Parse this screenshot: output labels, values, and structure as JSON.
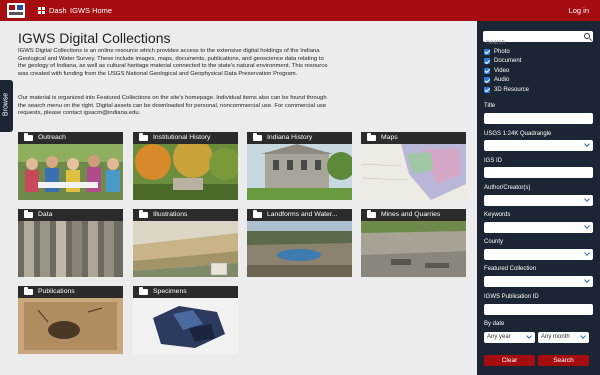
{
  "topbar": {
    "dash_label": "Dash",
    "home_label": "IGWS Home",
    "login_label": "Log in"
  },
  "browse_label": "Browse",
  "main": {
    "title": "IGWS Digital Collections",
    "intro": "IGWS Digital Collections is an online resource which provides access to the extensive digital holdings of the Indiana Geological and Water Survey. These include images, maps, documents, publications, and geoscience data relating to the geology of Indiana, as well as cultural heritage material connected to the state's natural environment. This resource was created with funding from the USGS National Geological and Geophysical Data Preservation Program.",
    "intro2": "Our material is organized into Featured Collections on the site's homepage. Individual items also can be found through the search menu on the right. Digital assets can be downloaded for personal, noncommercial use. For commercial use requests, please contact igsacm@indiana.edu.",
    "collections": [
      {
        "label": "Outreach"
      },
      {
        "label": "Institutional History"
      },
      {
        "label": "Indiana History"
      },
      {
        "label": "Maps"
      },
      {
        "label": "Data"
      },
      {
        "label": "Illustrations"
      },
      {
        "label": "Landforms and Water..."
      },
      {
        "label": "Mines and Quarries"
      },
      {
        "label": "Publications"
      },
      {
        "label": "Specimens"
      }
    ]
  },
  "sidebar": {
    "search_placeholder": "Search",
    "types": [
      {
        "label": "Photo",
        "checked": true
      },
      {
        "label": "Document",
        "checked": true
      },
      {
        "label": "Video",
        "checked": true
      },
      {
        "label": "Audio",
        "checked": true
      },
      {
        "label": "3D Resource",
        "checked": true
      }
    ],
    "fields": {
      "title": "Title",
      "quadrangle": "USGS 1:24K Quadrangle",
      "igs_id": "IGS ID",
      "author": "Author/Creator(s)",
      "keywords": "Keywords",
      "county": "County",
      "featured": "Featured Collection",
      "pub_id": "IGWS Publication ID",
      "by_date": "By date"
    },
    "any_year": "Any year",
    "any_month": "Any month",
    "clear_label": "Clear",
    "search_label": "Search"
  },
  "colors": {
    "brand": "#a50d10",
    "sidebar": "#1c2533",
    "checkbox": "#2f7bd6"
  }
}
